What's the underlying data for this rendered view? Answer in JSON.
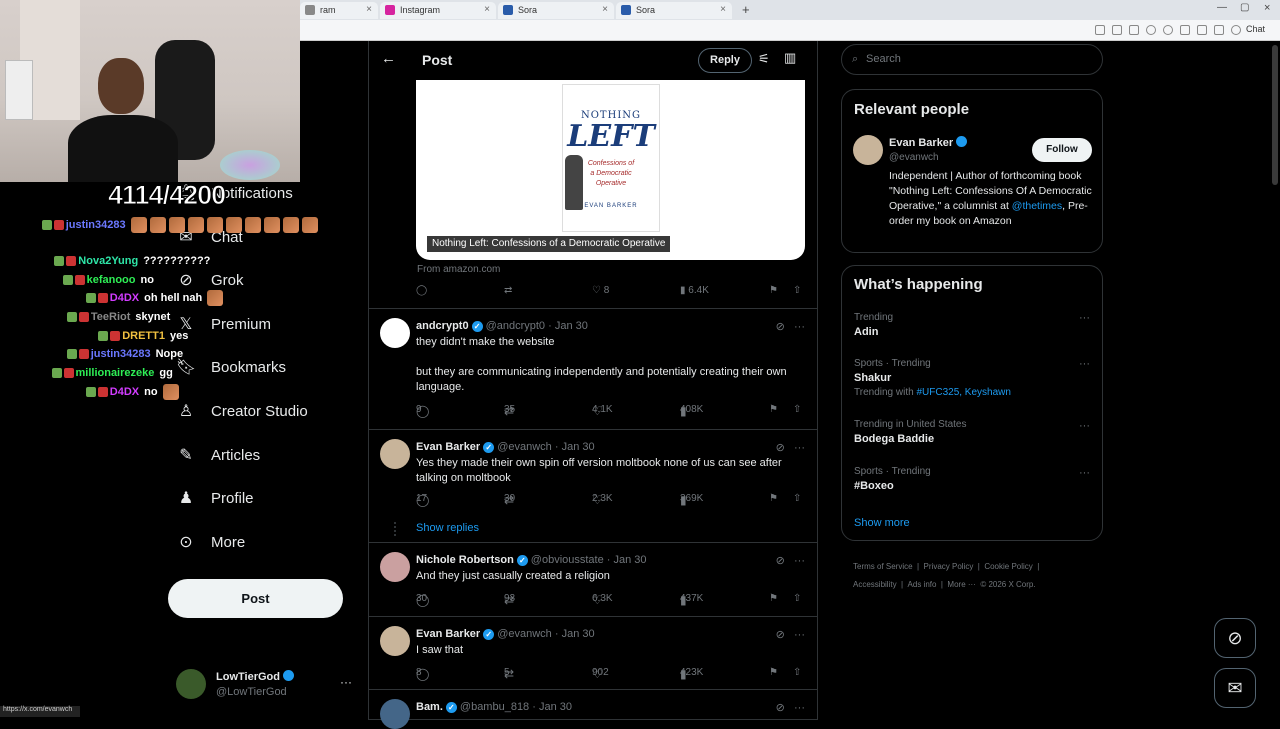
{
  "browser": {
    "tabs": [
      {
        "label": "ram",
        "fav": "#888"
      },
      {
        "label": "Instagram",
        "fav": "#d6249f"
      },
      {
        "label": "Sora",
        "fav": "#2a5caa"
      },
      {
        "label": "Sora",
        "fav": "#2a5caa"
      }
    ],
    "new_tab": "+",
    "status_url": "https://x.com/evanwch"
  },
  "stream": {
    "counter": "4114/4200"
  },
  "chat": [
    {
      "user": "justin34283",
      "color": "#6b78ff",
      "msg": "",
      "emotes": 10
    },
    {
      "user": "Nova2Yung",
      "color": "#2ee6a8",
      "msg": "??????????",
      "emotes": 0
    },
    {
      "user": "kefanooo",
      "color": "#2eee55",
      "msg": "no",
      "emotes": 0
    },
    {
      "user": "D4DX",
      "color": "#d23cff",
      "msg": "oh hell nah",
      "emotes": 1
    },
    {
      "user": "TeeRiot",
      "color": "#888888",
      "msg": "skynet",
      "emotes": 0
    },
    {
      "user": "DRETT1",
      "color": "#f0c040",
      "msg": "yes",
      "emotes": 0
    },
    {
      "user": "justin34283",
      "color": "#6b78ff",
      "msg": "Nope",
      "emotes": 0
    },
    {
      "user": "millionairezeke",
      "color": "#2eee55",
      "msg": "gg",
      "emotes": 0
    },
    {
      "user": "D4DX",
      "color": "#d23cff",
      "msg": "no",
      "emotes": 1
    }
  ],
  "sidebar": {
    "items": [
      {
        "label": "Notifications",
        "icon": "bell-icon"
      },
      {
        "label": "Chat",
        "icon": "mail-icon"
      },
      {
        "label": "Grok",
        "icon": "grok-icon"
      },
      {
        "label": "Premium",
        "icon": "x-logo-icon"
      },
      {
        "label": "Bookmarks",
        "icon": "bookmark-icon"
      },
      {
        "label": "Creator Studio",
        "icon": "creator-icon"
      },
      {
        "label": "Articles",
        "icon": "article-icon"
      },
      {
        "label": "Profile",
        "icon": "person-icon"
      },
      {
        "label": "More",
        "icon": "more-circle-icon"
      }
    ],
    "post_label": "Post",
    "account": {
      "name": "LowTierGod",
      "handle": "@LowTierGod"
    }
  },
  "header": {
    "title": "Post",
    "reply_label": "Reply"
  },
  "card": {
    "book_title_1": "NOTHING",
    "book_title_2": "LEFT",
    "book_sub": "Confessions of a Democratic Operative",
    "book_author": "EVAN BARKER",
    "caption": "Nothing Left: Confessions of a Democratic Operative",
    "source": "From amazon.com",
    "likes": "8",
    "views": "6.4K"
  },
  "tweets": [
    {
      "name": "andcrypt0",
      "handle": "@andcrypt0 · Jan 30",
      "text1": "they didn't make the website",
      "text2": "but they are communicating independently and potentially creating their own language.",
      "replies": "9",
      "reposts": "35",
      "likes": "4.1K",
      "views": "408K"
    },
    {
      "name": "Evan Barker",
      "handle": "@evanwch · Jan 30",
      "text1": "Yes they made their own spin off version moltbook none of us can see after talking on moltbook",
      "replies": "17",
      "reposts": "30",
      "likes": "2.3K",
      "views": "369K",
      "show_replies": "Show replies"
    },
    {
      "name": "Nichole Robertson",
      "handle": "@obviousstate · Jan 30",
      "text1": "And they just casually created a religion",
      "replies": "30",
      "reposts": "93",
      "likes": "6.3K",
      "views": "437K"
    },
    {
      "name": "Evan Barker",
      "handle": "@evanwch · Jan 30",
      "text1": "I saw that",
      "replies": "8",
      "reposts": "5",
      "likes": "902",
      "views": "423K"
    },
    {
      "name": "Bam.",
      "handle": "@bambu_818 · Jan 30"
    }
  ],
  "search": {
    "placeholder": "Search"
  },
  "relevant": {
    "title": "Relevant people",
    "name": "Evan Barker",
    "handle": "@evanwch",
    "follow": "Follow",
    "bio_1": "Independent | Author of forthcoming book \"Nothing Left: Confessions Of A Democratic Operative,\" a columnist at ",
    "bio_link": "@thetimes",
    "bio_2": ", Pre-order my book on Amazon"
  },
  "happening": {
    "title": "What’s happening",
    "trends": [
      {
        "meta": "Trending",
        "name": "Adin"
      },
      {
        "meta": "Sports · Trending",
        "name": "Shakur",
        "extra": "Trending with",
        "tags": "#UFC325, Keyshawn"
      },
      {
        "meta": "Trending in United States",
        "name": "Bodega Baddie"
      },
      {
        "meta": "Sports · Trending",
        "name": "#Boxeo"
      }
    ],
    "show_more": "Show more"
  },
  "footer": {
    "line1": [
      "Terms of Service",
      "Privacy Policy",
      "Cookie Policy"
    ],
    "line2": [
      "Accessibility",
      "Ads info",
      "More ···",
      "© 2026 X Corp."
    ]
  },
  "colors": {
    "accent": "#1d9bf0",
    "bg": "#000000",
    "border": "#2f3336"
  }
}
